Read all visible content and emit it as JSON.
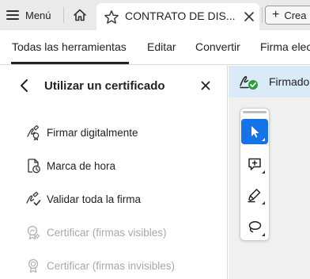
{
  "tabbar": {
    "menu_label": "Menú",
    "doc_tab_title": "CONTRATO DE DIS...",
    "create_label": "Crea"
  },
  "menubar": {
    "items": [
      "Todas las herramientas",
      "Editar",
      "Convertir",
      "Firma elec"
    ],
    "active_index": 0
  },
  "panel": {
    "title": "Utilizar un certificado",
    "tools": [
      {
        "label": "Firmar digitalmente",
        "icon": "digital-sign-icon",
        "enabled": true
      },
      {
        "label": "Marca de hora",
        "icon": "timestamp-icon",
        "enabled": true
      },
      {
        "label": "Validar toda la firma",
        "icon": "validate-signature-icon",
        "enabled": true
      },
      {
        "label": "Certificar (firmas visibles)",
        "icon": "certify-visible-icon",
        "enabled": false
      },
      {
        "label": "Certificar (firmas invisibles)",
        "icon": "certify-invisible-icon",
        "enabled": false
      }
    ]
  },
  "signed_bar": {
    "label": "Firmado",
    "icon": "signature-valid-icon"
  },
  "toolbox": {
    "tools": [
      "select-cursor-icon",
      "add-comment-icon",
      "highlight-pen-icon",
      "lasso-icon"
    ],
    "active_index": 0
  },
  "colors": {
    "accent": "#1473e6",
    "signed_bar_bg": "#dbeaf9",
    "valid_green": "#2d9d3a",
    "disabled_text": "#a8a8a8"
  }
}
